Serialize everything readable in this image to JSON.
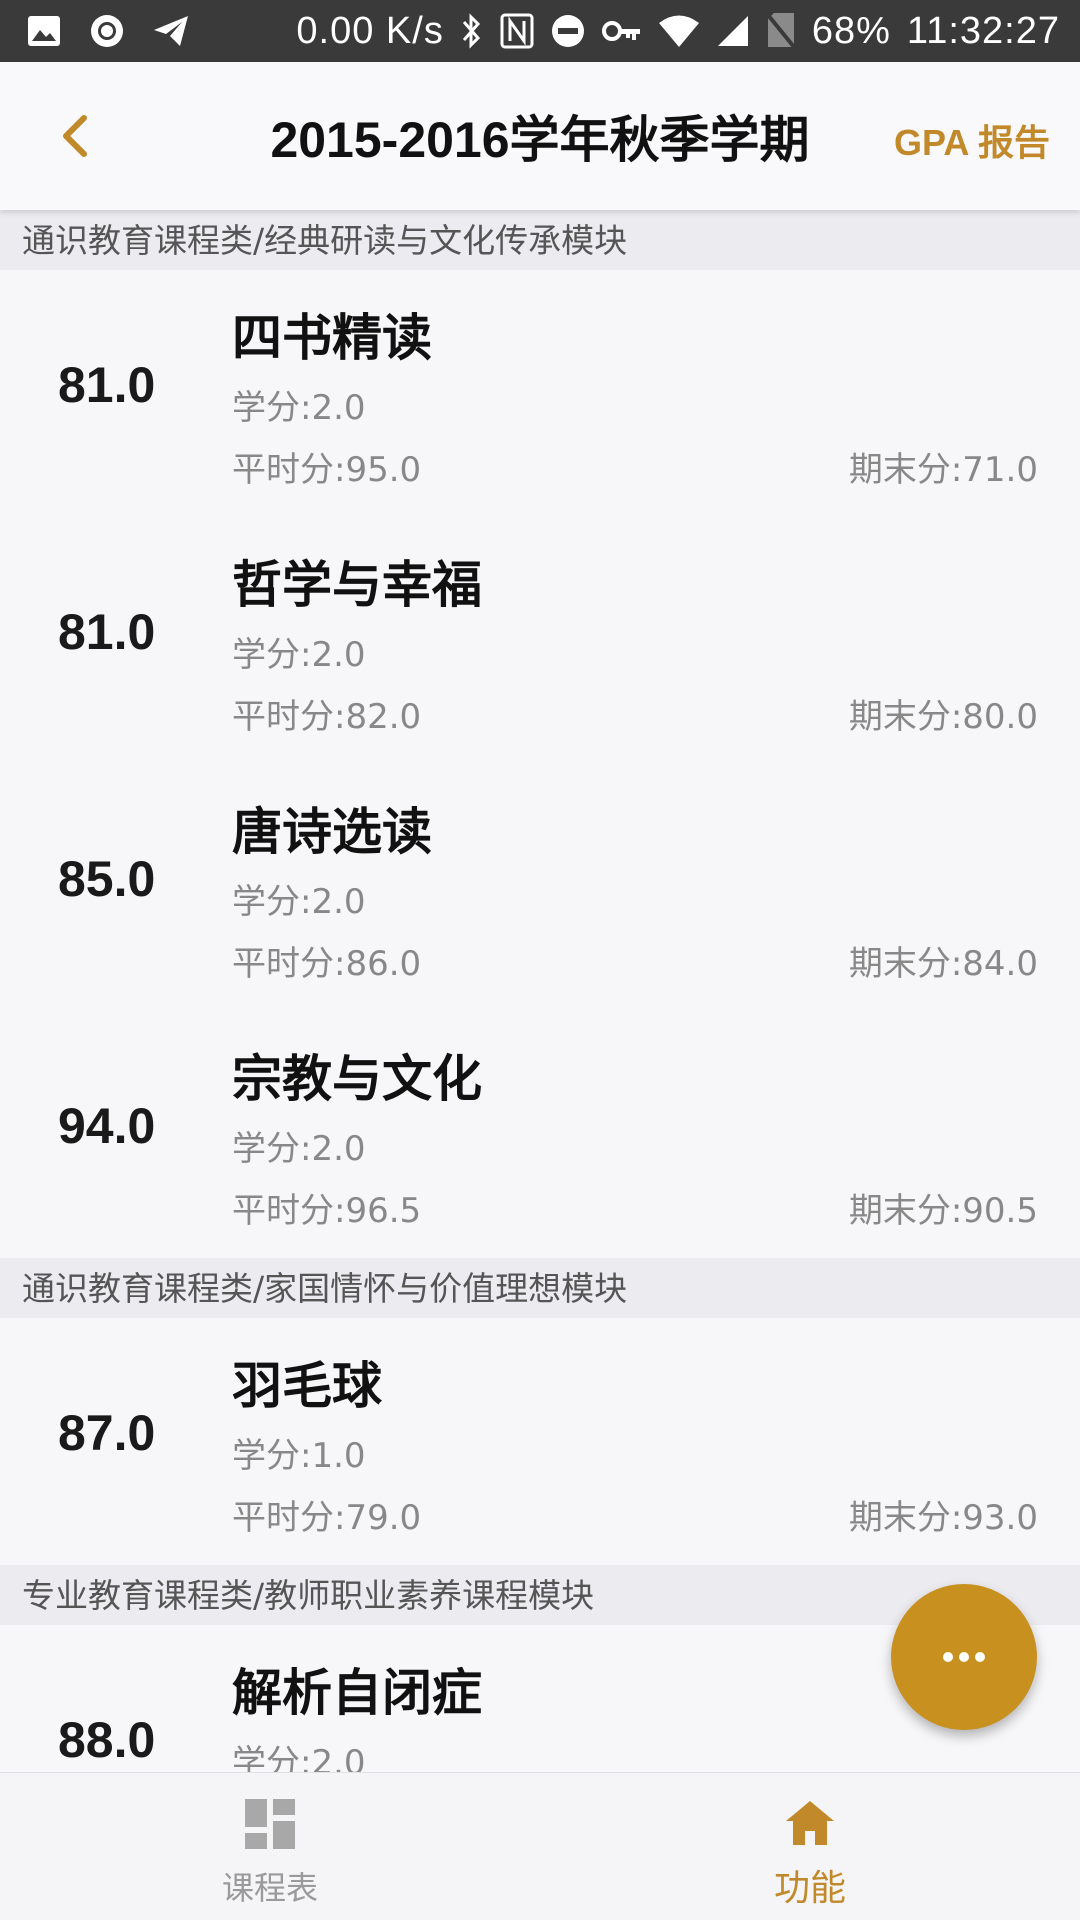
{
  "status_bar": {
    "network_speed": "0.00 K/s",
    "battery": "68%",
    "time": "11:32:27"
  },
  "header": {
    "title": "2015-2016学年秋季学期",
    "gpa_link": "GPA 报告"
  },
  "sections": [
    {
      "title": "通识教育课程类/经典研读与文化传承模块",
      "courses": [
        {
          "score": "81.0",
          "name": "四书精读",
          "credit": "学分:2.0",
          "usual": "平时分:95.0",
          "final": "期末分:71.0"
        },
        {
          "score": "81.0",
          "name": "哲学与幸福",
          "credit": "学分:2.0",
          "usual": "平时分:82.0",
          "final": "期末分:80.0"
        },
        {
          "score": "85.0",
          "name": "唐诗选读",
          "credit": "学分:2.0",
          "usual": "平时分:86.0",
          "final": "期末分:84.0"
        },
        {
          "score": "94.0",
          "name": "宗教与文化",
          "credit": "学分:2.0",
          "usual": "平时分:96.5",
          "final": "期末分:90.5"
        }
      ]
    },
    {
      "title": "通识教育课程类/家国情怀与价值理想模块",
      "courses": [
        {
          "score": "87.0",
          "name": "羽毛球",
          "credit": "学分:1.0",
          "usual": "平时分:79.0",
          "final": "期末分:93.0"
        }
      ]
    },
    {
      "title": "专业教育课程类/教师职业素养课程模块",
      "courses": [
        {
          "score": "88.0",
          "name": "解析自闭症",
          "credit": "学分:2.0"
        }
      ]
    }
  ],
  "bottom_nav": {
    "items": [
      {
        "label": "课程表",
        "icon": "dashboard-icon",
        "active": false
      },
      {
        "label": "功能",
        "icon": "home-icon",
        "active": true
      }
    ]
  },
  "colors": {
    "accent": "#c2892b",
    "fab": "#c8901f",
    "status_bar": "#3a3a3a",
    "section_bg": "#ececf0"
  }
}
